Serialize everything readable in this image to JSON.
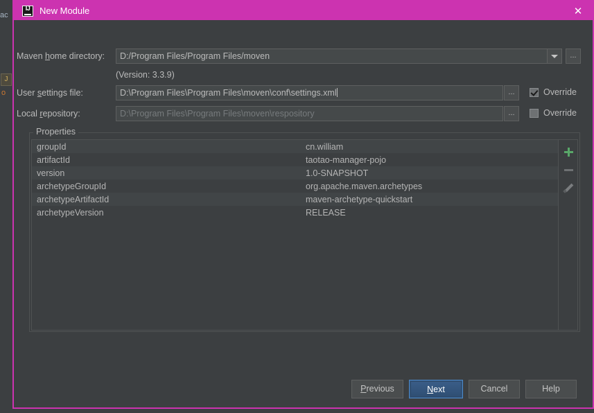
{
  "background": {
    "fragment_top": "ac",
    "tab_glyph": "J",
    "fragment_low": "o"
  },
  "titlebar": {
    "logo_text": "IJ",
    "title": "New Module",
    "close_icon": "✕"
  },
  "form": {
    "maven_home": {
      "label_pre": "Maven ",
      "label_mnemonic": "h",
      "label_post": "ome directory:",
      "value": "D:/Program Files/Program Files/moven",
      "dropdown_icon": "chevron-down-icon",
      "browse_label": "..."
    },
    "version_note": "(Version: 3.3.9)",
    "user_settings": {
      "label_pre": "User ",
      "label_mnemonic": "s",
      "label_post": "ettings file:",
      "value": "D:\\Program Files\\Program Files\\moven\\conf\\settings.xml",
      "browse_label": "...",
      "override_label": "Override",
      "override_checked": true
    },
    "local_repository": {
      "label_pre": "Local ",
      "label_mnemonic": "r",
      "label_post": "epository:",
      "value": "D:\\Program Files\\Program Files\\moven\\respository",
      "browse_label": "...",
      "override_label": "Override",
      "override_checked": false
    }
  },
  "properties": {
    "group_title": "Properties",
    "rows": [
      {
        "key": "groupId",
        "value": "cn.william"
      },
      {
        "key": "artifactId",
        "value": "taotao-manager-pojo"
      },
      {
        "key": "version",
        "value": "1.0-SNAPSHOT"
      },
      {
        "key": "archetypeGroupId",
        "value": "org.apache.maven.archetypes"
      },
      {
        "key": "archetypeArtifactId",
        "value": "maven-archetype-quickstart"
      },
      {
        "key": "archetypeVersion",
        "value": "RELEASE"
      }
    ],
    "toolbar": {
      "add_icon": "plus-icon",
      "remove_icon": "minus-icon",
      "edit_icon": "pencil-icon"
    }
  },
  "footer": {
    "previous": {
      "pre": "",
      "mnemonic": "P",
      "post": "revious"
    },
    "next": {
      "pre": "",
      "mnemonic": "N",
      "post": "ext"
    },
    "cancel": {
      "pre": "Cancel",
      "mnemonic": "",
      "post": ""
    },
    "help": {
      "pre": "Help",
      "mnemonic": "",
      "post": ""
    }
  },
  "colors": {
    "accent": "#cc33b0",
    "dialog_bg": "#3c3f41",
    "field_bg": "#45494a",
    "default_button": "#365880",
    "add_icon": "#59a869"
  }
}
